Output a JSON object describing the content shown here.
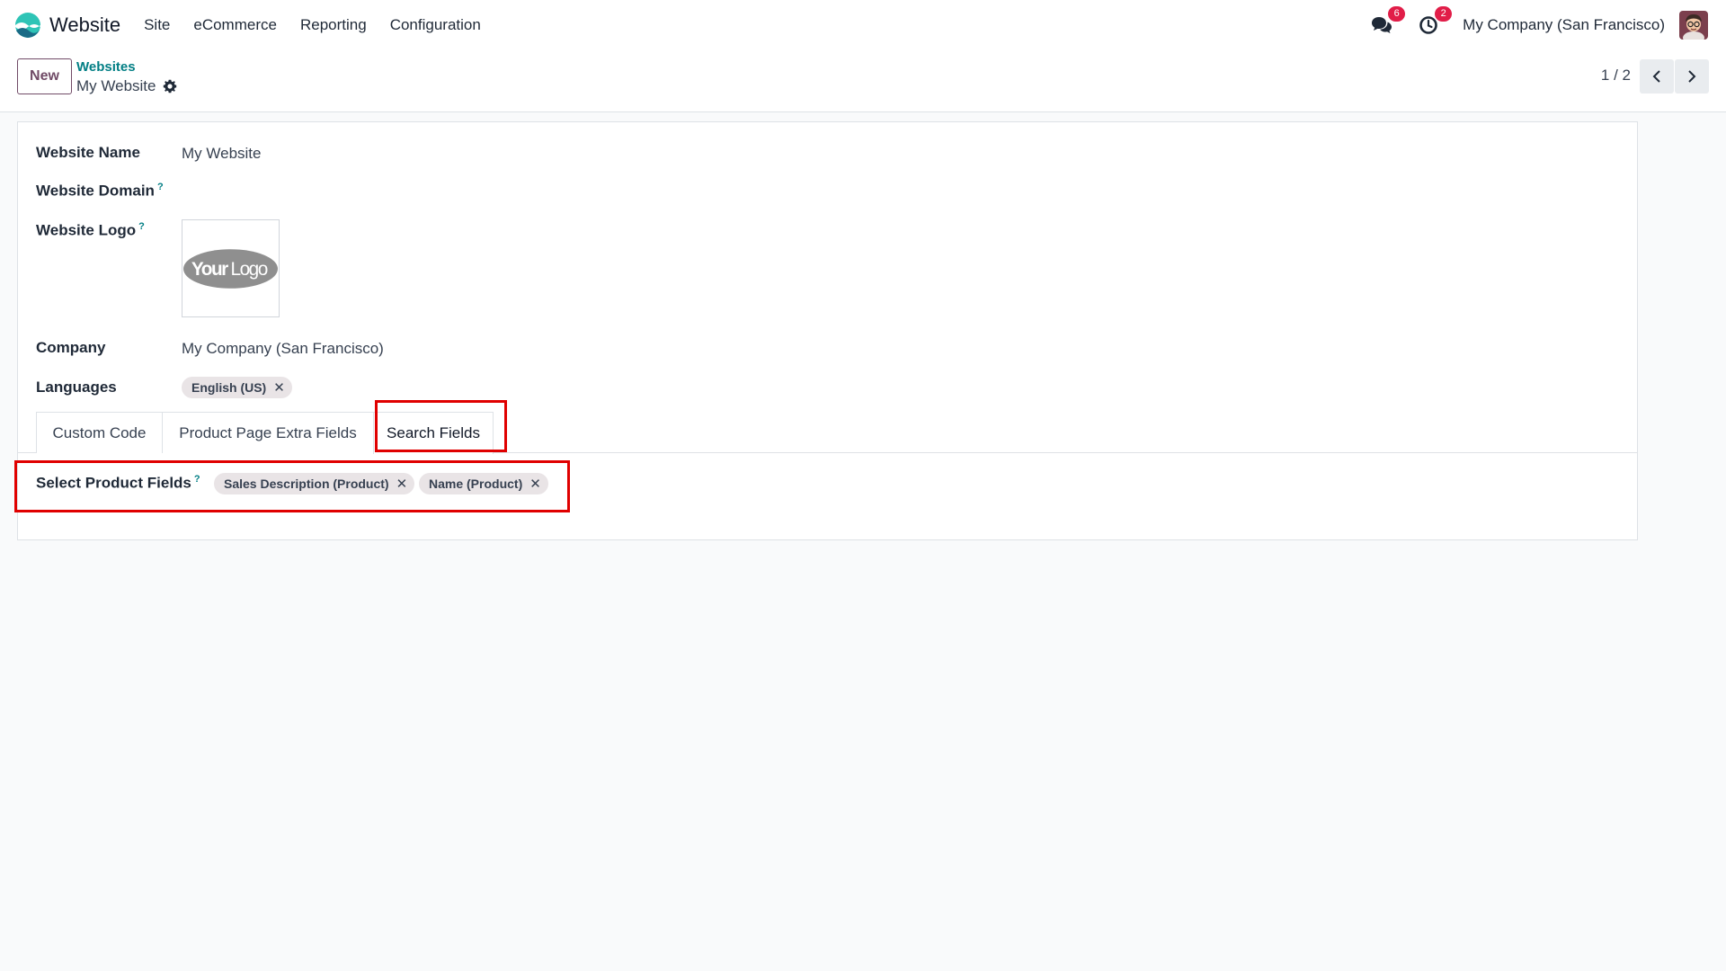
{
  "navbar": {
    "app_name": "Website",
    "menu": [
      "Site",
      "eCommerce",
      "Reporting",
      "Configuration"
    ],
    "messages_icon": "chat-bubbles-icon",
    "messages_count": "6",
    "activities_icon": "clock-icon",
    "activities_count": "2",
    "company": "My Company (San Francisco)"
  },
  "control_panel": {
    "new_label": "New",
    "breadcrumb": "Websites",
    "record_name": "My Website",
    "pager": "1 / 2"
  },
  "form": {
    "website_name_label": "Website Name",
    "website_name_value": "My Website",
    "website_domain_label": "Website Domain",
    "website_logo_label": "Website Logo",
    "logo_text_your": "Your",
    "logo_text_logo": "Logo",
    "company_label": "Company",
    "company_value": "My Company (San Francisco)",
    "languages_label": "Languages",
    "languages": [
      "English (US)"
    ],
    "help_mark": "?",
    "tabs": [
      "Custom Code",
      "Product Page Extra Fields",
      "Search Fields"
    ],
    "active_tab": "Search Fields",
    "select_fields_label": "Select Product Fields",
    "product_fields": [
      "Sales Description (Product)",
      "Name (Product)"
    ],
    "tag_remove": "✕"
  },
  "colors": {
    "accent": "#714b67",
    "link": "#017e84",
    "badge": "#e11d48",
    "highlight": "#e00000"
  }
}
